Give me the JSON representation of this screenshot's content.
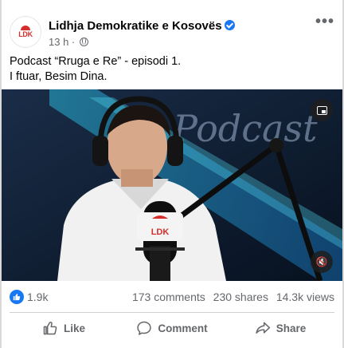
{
  "post": {
    "page_name": "Lidhja Demokratike e Kosovës",
    "avatar_text": "LDK",
    "time": "13 h",
    "caption_line1": "Podcast “Rruga e Re” - episodi 1.",
    "caption_line2": "I ftuar, Besim Dina."
  },
  "video": {
    "watermark_text": "Podcast",
    "mic_logo_text": "LDK",
    "pip_icon": "picture-in-picture-icon",
    "mute_icon": "speaker-muted-icon"
  },
  "stats": {
    "likes": "1.9k",
    "comments": "173 comments",
    "shares": "230 shares",
    "views": "14.3k views"
  },
  "actions": {
    "like": "Like",
    "comment": "Comment",
    "share": "Share"
  },
  "colors": {
    "brand_blue": "#1877f2",
    "ldk_red": "#d62d2d",
    "secondary_text": "#65676b"
  }
}
